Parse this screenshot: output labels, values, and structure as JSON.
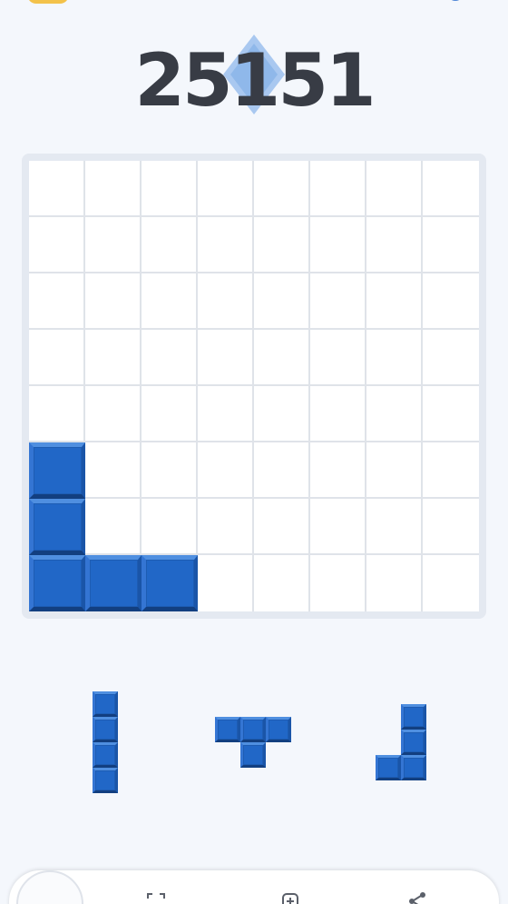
{
  "score": {
    "value": "25151",
    "accent_color": "#8fb8ea"
  },
  "board": {
    "rows": 8,
    "cols": 8,
    "block_color": "#2167c7",
    "filled": [
      [
        5,
        0
      ],
      [
        6,
        0
      ],
      [
        7,
        0
      ],
      [
        7,
        1
      ],
      [
        7,
        2
      ]
    ]
  },
  "tray": {
    "pieces": [
      {
        "name": "vertical-i4-piece",
        "cells": [
          [
            0,
            0
          ],
          [
            1,
            0
          ],
          [
            2,
            0
          ],
          [
            3,
            0
          ]
        ]
      },
      {
        "name": "t-piece",
        "cells": [
          [
            0,
            0
          ],
          [
            0,
            1
          ],
          [
            0,
            2
          ],
          [
            1,
            1
          ]
        ]
      },
      {
        "name": "j-piece",
        "cells": [
          [
            0,
            1
          ],
          [
            1,
            1
          ],
          [
            2,
            0
          ],
          [
            2,
            1
          ]
        ]
      }
    ]
  },
  "icons": {
    "top_right": "gear-icon",
    "bottom_nav": [
      "avatar-icon",
      "scan-icon",
      "add-icon",
      "share-icon"
    ]
  }
}
